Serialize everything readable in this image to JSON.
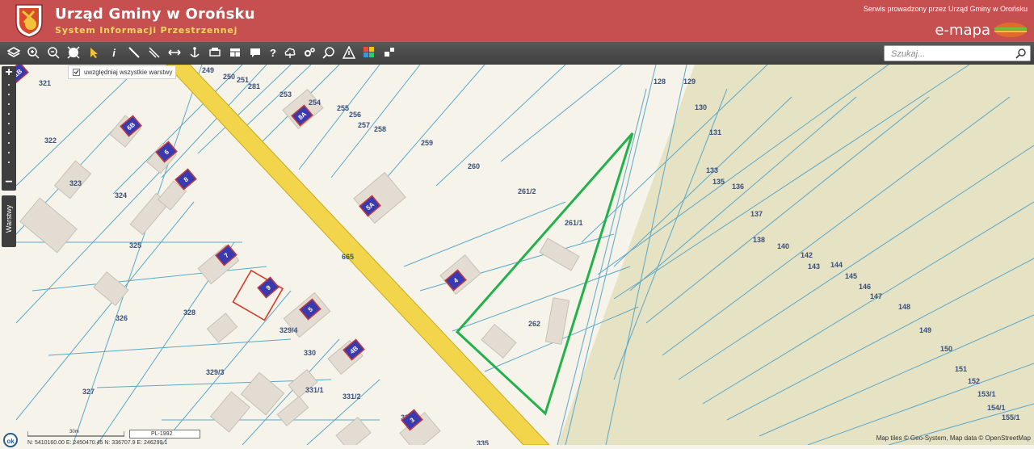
{
  "header": {
    "title": "Urząd Gminy w Orońsku",
    "subtitle": "System Informacji Przestrzennej",
    "service_note": "Serwis prowadzony przez Urząd Gminy w Orońsku",
    "brand": "e-mapa"
  },
  "toolbar": {
    "tools": [
      "layers-icon",
      "zoom-in-icon",
      "zoom-out-icon",
      "full-extent-icon",
      "select-arrow-icon",
      "info-icon",
      "measure-line-icon",
      "measure-area-icon",
      "pan-icon",
      "anchor-icon",
      "print-icon",
      "table-icon",
      "comment-icon",
      "help-icon",
      "cloud-icon",
      "settings-icon",
      "search-map-icon",
      "warning-icon",
      "color-grid-icon",
      "share-icon"
    ],
    "info_label": "i",
    "help_label": "?"
  },
  "search": {
    "placeholder": "Szukaj..."
  },
  "map": {
    "layers_checkbox_label": "uwzględniaj wszystkie warstwy",
    "layers_tab_label": "Warstwy",
    "zoom_in": "+",
    "zoom_out": "−",
    "parcel_labels": [
      {
        "t": "249"
      },
      {
        "t": "250"
      },
      {
        "t": "251"
      },
      {
        "t": "281"
      },
      {
        "t": "253"
      },
      {
        "t": "254"
      },
      {
        "t": "255"
      },
      {
        "t": "256"
      },
      {
        "t": "257"
      },
      {
        "t": "258"
      },
      {
        "t": "259"
      },
      {
        "t": "260"
      },
      {
        "t": "261/2"
      },
      {
        "t": "261/1"
      },
      {
        "t": "262"
      },
      {
        "t": "128"
      },
      {
        "t": "129"
      },
      {
        "t": "130"
      },
      {
        "t": "131"
      },
      {
        "t": "133"
      },
      {
        "t": "135"
      },
      {
        "t": "136"
      },
      {
        "t": "137"
      },
      {
        "t": "138"
      },
      {
        "t": "140"
      },
      {
        "t": "142"
      },
      {
        "t": "143"
      },
      {
        "t": "144"
      },
      {
        "t": "145"
      },
      {
        "t": "146"
      },
      {
        "t": "147"
      },
      {
        "t": "148"
      },
      {
        "t": "149"
      },
      {
        "t": "150"
      },
      {
        "t": "151"
      },
      {
        "t": "152"
      },
      {
        "t": "153/1"
      },
      {
        "t": "154/1"
      },
      {
        "t": "155/1"
      },
      {
        "t": "321"
      },
      {
        "t": "322"
      },
      {
        "t": "323"
      },
      {
        "t": "324"
      },
      {
        "t": "325"
      },
      {
        "t": "326"
      },
      {
        "t": "327"
      },
      {
        "t": "328"
      },
      {
        "t": "329/4"
      },
      {
        "t": "329/3"
      },
      {
        "t": "330"
      },
      {
        "t": "331/1"
      },
      {
        "t": "331/2"
      },
      {
        "t": "331/3"
      },
      {
        "t": "665"
      },
      {
        "t": "335"
      }
    ],
    "address_labels": [
      "8A",
      "5A",
      "4",
      "6B",
      "6",
      "8",
      "7",
      "9",
      "5",
      "4B",
      "1B",
      "3"
    ],
    "attribution": "Map tiles © Geo-System, Map data © OpenStreetMap",
    "scale_label": "30m",
    "crs": "PL-1992",
    "coordinates": "N: 5410160.00 E: 2450470.45  N: 336707.9  E: 246299.1",
    "ok_badge": "ok"
  },
  "colors": {
    "header_bg": "#c5504f",
    "road": "#f3d54b",
    "parcel_line": "#5aa8c8",
    "selection": "#22b14c",
    "forest": "#e6e2c4"
  }
}
